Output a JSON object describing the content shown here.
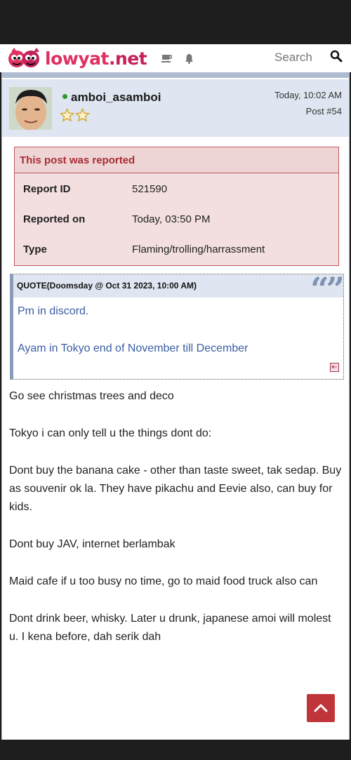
{
  "site": {
    "name": "lowyat",
    "tld": ".net"
  },
  "search": {
    "label": "Search"
  },
  "post": {
    "username": "amboi_asamboi",
    "time": "Today, 10:02 AM",
    "number": "Post #54",
    "rank_stars": 2
  },
  "report": {
    "title": "This post was reported",
    "rows": [
      {
        "key": "Report ID",
        "value": "521590"
      },
      {
        "key": "Reported on",
        "value": "Today, 03:50 PM"
      },
      {
        "key": "Type",
        "value": "Flaming/trolling/harrassment"
      }
    ]
  },
  "quote": {
    "header": "QUOTE(Doomsday @ Oct 31 2023, 10:00 AM)",
    "lines": [
      "Pm in discord.",
      "Ayam in Tokyo end of November till December"
    ]
  },
  "body": [
    "Go see christmas trees and deco",
    "Tokyo i can only tell u the things dont do:",
    "Dont buy the banana cake - other than taste sweet, tak sedap. Buy as souvenir ok la. They have pikachu and Eevie also, can buy for kids.",
    "Dont buy JAV, internet berlambak",
    "Maid cafe if u too busy no time, go to maid food truck also can",
    "Dont drink beer, whisky. Later u drunk, japanese amoi will molest u. I kena before, dah serik dah"
  ],
  "colors": {
    "brand": "#e03060",
    "report_border": "#c0575c",
    "report_title": "#a72d35",
    "quote_text": "#3b5ea3",
    "header_bg": "#dfe6f1",
    "scroll_top": "#c0353a"
  }
}
